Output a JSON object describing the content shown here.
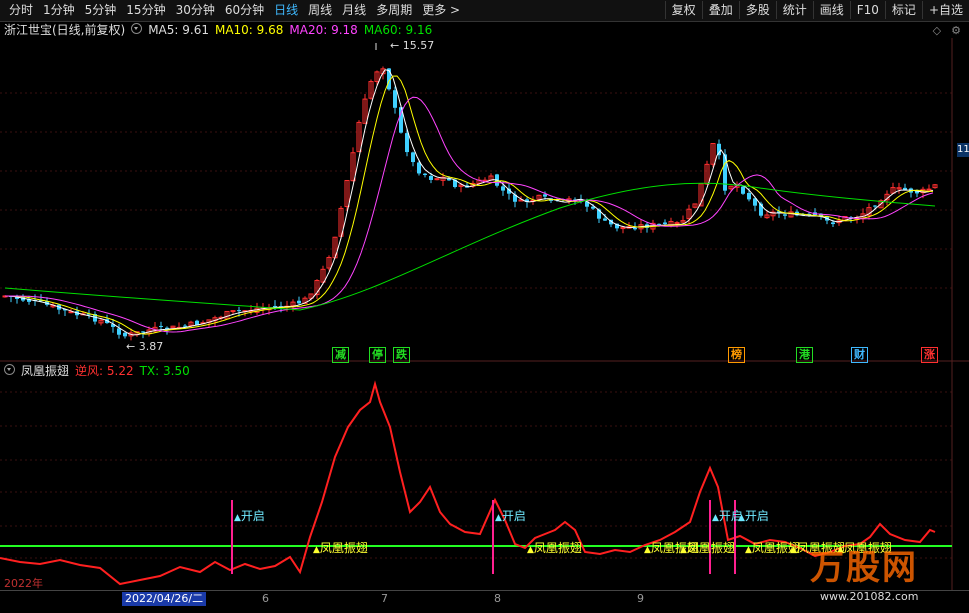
{
  "toolbar": {
    "periods": [
      "分时",
      "1分钟",
      "5分钟",
      "15分钟",
      "30分钟",
      "60分钟",
      "日线",
      "周线",
      "月线",
      "多周期",
      "更多 >"
    ],
    "active_period": "日线",
    "right_buttons": [
      "复权",
      "叠加",
      "多股",
      "统计",
      "画线",
      "F10",
      "标记",
      "+自选"
    ]
  },
  "info": {
    "title": "浙江世宝(日线,前复权)",
    "ma5": "MA5: 9.61",
    "ma10": "MA10: 9.68",
    "ma20": "MA20: 9.18",
    "ma60": "MA60: 9.16",
    "high_label": "15.57",
    "low_label": "3.87",
    "right_price_tag": "11"
  },
  "events": [
    {
      "text": "减",
      "color": "#22dd22"
    },
    {
      "text": "停",
      "color": "#22dd22"
    },
    {
      "text": "跌",
      "color": "#22dd22"
    },
    {
      "text": "榜",
      "color": "#ff9a00"
    },
    {
      "text": "港",
      "color": "#22dd22"
    },
    {
      "text": "财",
      "color": "#3fb9ff"
    },
    {
      "text": "涨",
      "color": "#ff3030"
    }
  ],
  "indicator": {
    "name": "凤凰振翅",
    "nifeng": "逆风: 5.22",
    "tx": "TX: 3.50",
    "signals": [
      {
        "label": "开启",
        "type": "open"
      },
      {
        "label": "凤凰振翅",
        "type": "wing"
      },
      {
        "label": "开启",
        "type": "open"
      },
      {
        "label": "凤凰振翅",
        "type": "wing"
      },
      {
        "label": "凤凰振翅",
        "type": "wing"
      },
      {
        "label": "凤凰振翅",
        "type": "wing"
      },
      {
        "label": "开启",
        "type": "open"
      },
      {
        "label": "开启",
        "type": "open"
      },
      {
        "label": "凤凰振翅",
        "type": "wing"
      },
      {
        "label": "凤凰振翅",
        "type": "wing"
      },
      {
        "label": "凤凰振翅",
        "type": "wing"
      }
    ]
  },
  "axis": {
    "year": "2022年",
    "cursor_date": "2022/04/26/二",
    "months": [
      "6",
      "7",
      "8",
      "9"
    ]
  },
  "watermark": {
    "text": "万股网",
    "url": "www.201082.com"
  },
  "colors": {
    "up": "#ff3030",
    "down": "#3fd0ff",
    "ma5": "#ffffff",
    "ma10": "#ffff00",
    "ma20": "#ff44ff",
    "ma60": "#00e000"
  }
}
